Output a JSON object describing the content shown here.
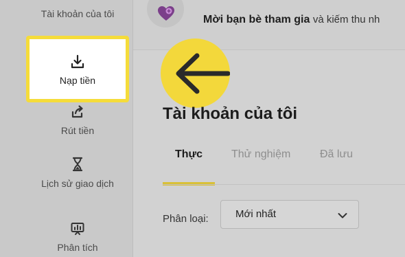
{
  "sidebar": {
    "items": [
      {
        "label": "Tài khoản của tôi"
      },
      {
        "label": "Nạp tiền",
        "icon": "download-icon",
        "highlighted": true
      },
      {
        "label": "Rút tiền",
        "icon": "withdraw-arrow-icon"
      },
      {
        "label": "Lịch sử giao dịch",
        "icon": "hourglass-icon"
      },
      {
        "label": "Phân tích",
        "icon": "analytics-chart-icon"
      }
    ]
  },
  "banner": {
    "bold_text": "Mời bạn bè tham gia",
    "rest_text": "và kiếm thu nh",
    "icon": "heart-plus-icon"
  },
  "overlay": {
    "icon": "arrow-left-icon",
    "color": "#f3d83b"
  },
  "main": {
    "title": "Tài khoản của tôi",
    "tabs": [
      {
        "label": "Thực",
        "active": true
      },
      {
        "label": "Thử nghiệm",
        "active": false
      },
      {
        "label": "Đã lưu",
        "active": false
      }
    ],
    "filter": {
      "label": "Phân loại:",
      "selected": "Mới nhất",
      "icon": "chevron-down-icon"
    }
  },
  "colors": {
    "highlight": "#f5dc3a",
    "accent_underline": "#d9c036",
    "heart": "#7b3f8a"
  }
}
